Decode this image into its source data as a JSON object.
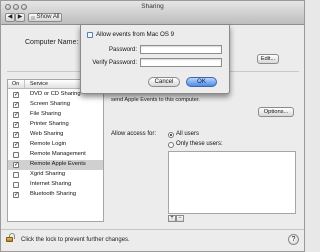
{
  "window": {
    "title": "Sharing",
    "nav_back": "◀",
    "nav_forward": "▶",
    "show_all": "Show All"
  },
  "main": {
    "computer_name_label": "Computer Name:",
    "edit_label": "Edit..."
  },
  "services": {
    "header_on": "On",
    "header_service": "Service",
    "items": [
      {
        "label": "DVD or CD Sharing",
        "checked": true
      },
      {
        "label": "Screen Sharing",
        "checked": true
      },
      {
        "label": "File Sharing",
        "checked": true
      },
      {
        "label": "Printer Sharing",
        "checked": true
      },
      {
        "label": "Web Sharing",
        "checked": true
      },
      {
        "label": "Remote Login",
        "checked": true
      },
      {
        "label": "Remote Management",
        "checked": false
      },
      {
        "label": "Remote Apple Events",
        "checked": true
      },
      {
        "label": "Xgrid Sharing",
        "checked": false
      },
      {
        "label": "Internet Sharing",
        "checked": false
      },
      {
        "label": "Bluetooth Sharing",
        "checked": true
      }
    ],
    "selected_index": 7
  },
  "details": {
    "description": "send Apple Events to this computer.",
    "options_label": "Options...",
    "access_label": "Allow access for:",
    "radio_all": "All users",
    "radio_only": "Only these users:",
    "plus": "+",
    "minus": "−"
  },
  "footer": {
    "lock_text": "Click the lock to prevent further changes.",
    "help": "?"
  },
  "sheet": {
    "checkbox_label": "Allow events from Mac OS 9",
    "password_label": "Password:",
    "verify_label": "Verify Password:",
    "cancel_label": "Cancel",
    "ok_label": "OK"
  }
}
